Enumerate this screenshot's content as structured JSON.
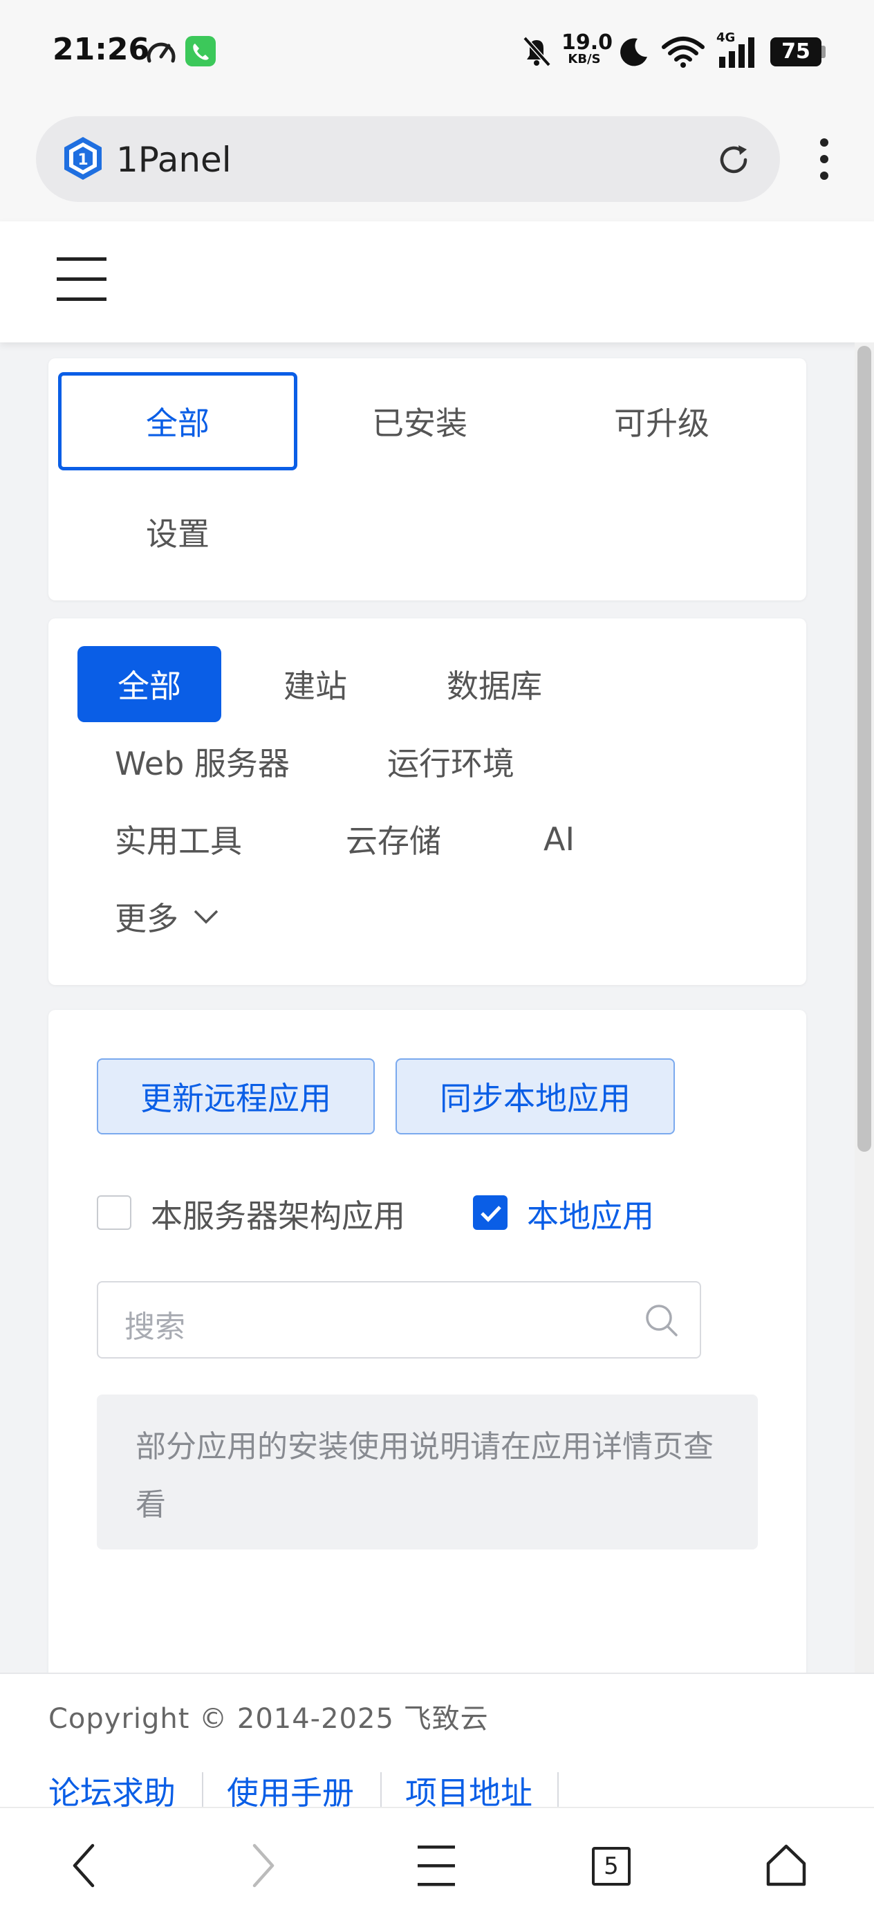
{
  "status_bar": {
    "time": "21:26",
    "net_speed_value": "19.0",
    "net_speed_unit": "KB/S",
    "network_type": "4G",
    "battery": "75"
  },
  "browser": {
    "url_title": "1Panel",
    "open_tabs_count": "5"
  },
  "app_tabs": [
    {
      "label": "全部",
      "active": true
    },
    {
      "label": "已安装",
      "active": false
    },
    {
      "label": "可升级",
      "active": false
    },
    {
      "label": "设置",
      "active": false
    }
  ],
  "categories": [
    {
      "label": "全部",
      "active": true
    },
    {
      "label": "建站"
    },
    {
      "label": "数据库"
    },
    {
      "label": "Web 服务器"
    },
    {
      "label": "运行环境"
    },
    {
      "label": "实用工具"
    },
    {
      "label": "云存储"
    },
    {
      "label": "AI"
    },
    {
      "label": "更多"
    }
  ],
  "actions": {
    "update_remote": "更新远程应用",
    "sync_local": "同步本地应用"
  },
  "filters": {
    "arch_label": "本服务器架构应用",
    "arch_checked": false,
    "local_label": "本地应用",
    "local_checked": true
  },
  "search": {
    "placeholder": "搜索"
  },
  "notice": {
    "text": "部分应用的安装使用说明请在应用详情页查看"
  },
  "footer": {
    "copyright": "Copyright © 2014-2025 飞致云",
    "links": [
      "论坛求助",
      "使用手册",
      "项目地址"
    ]
  },
  "colors": {
    "accent": "#0a5ee6",
    "light_accent_bg": "#e2ecfb",
    "page_bg": "#f2f3f5"
  }
}
